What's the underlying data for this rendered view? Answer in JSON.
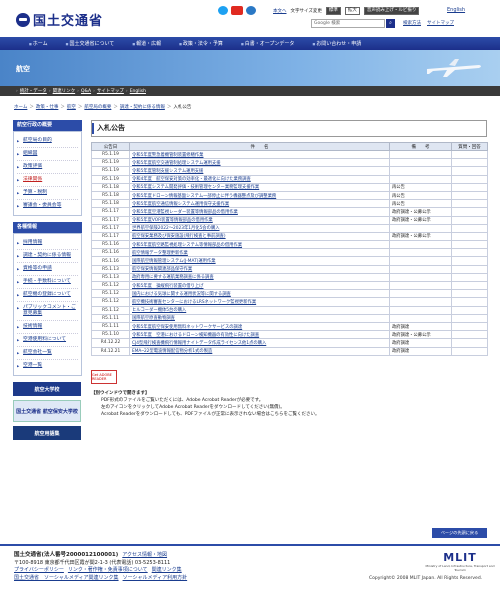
{
  "header": {
    "logo": "国土交通省",
    "links": [
      "本文へ",
      "文字サイズ変更",
      "標準",
      "拡大",
      "音声読み上げ・ルビ振り",
      "English"
    ],
    "search_placeholder": "Google 検索",
    "sub_links": [
      "検索方法",
      "サイトマップ"
    ]
  },
  "gnav": [
    "ホーム",
    "国土交通省について",
    "報道・広報",
    "政策・法令・予算",
    "白書・オープンデータ",
    "お問い合わせ・申請"
  ],
  "banner": {
    "title": "航空"
  },
  "subnav": [
    "統計・データ",
    "関連リンク",
    "Q&A",
    "サイトマップ",
    "English"
  ],
  "breadcrumb": [
    "ホーム",
    "政策・仕事",
    "航空",
    "航空局の概要",
    "調達・契約に係る情報",
    "入札公告"
  ],
  "side": {
    "sec1_title": "航空行政の概要",
    "sec1_items": [
      "航空局の目的",
      "組織図",
      "政策評価",
      "法律関係",
      "予算・税制",
      "審議会・委員会等"
    ],
    "sec2_title": "各種情報",
    "sec2_items": [
      "採用情報",
      "調達・契約に係る情報",
      "資格等の申請",
      "手続・手数料について",
      "航空機の登録について",
      "パブリックコメント・ご意見募集",
      "技術情報",
      "空港使用料について",
      "航空会社一覧",
      "空港一覧"
    ],
    "banners": [
      "航空大学校",
      "国土交通省 航空保安大学校",
      "航空用語集"
    ]
  },
  "main": {
    "title": "入札公告",
    "columns": [
      "公告日",
      "件　　名",
      "備　　考",
      "質問・回答"
    ],
    "rows": [
      {
        "date": "R5.1.19",
        "title": "令和5年度警急着機管制装置修繕作業",
        "note": "",
        "qa": ""
      },
      {
        "date": "R5.1.19",
        "title": "令和5年度航空交通管制処理システム運用支援",
        "note": "",
        "qa": ""
      },
      {
        "date": "R5.1.19",
        "title": "令和5年度管制支援システム運用支援",
        "note": "",
        "qa": ""
      },
      {
        "date": "R5.1.19",
        "title": "令和4年度　航空保安対策の効率化・最適化に向けた業務調査",
        "note": "",
        "qa": ""
      },
      {
        "date": "R5.1.18",
        "title": "令和5年度システム開発評価・技術管理センター業務監理支援作業",
        "note": "再公告",
        "qa": ""
      },
      {
        "date": "R5.1.18",
        "title": "令和5年度ドローン情報基盤システム一部停止に伴う機器整点及び調整業務",
        "note": "再公告",
        "qa": ""
      },
      {
        "date": "R5.1.18",
        "title": "令和5年度航空通信情報システム運用保守支援作業",
        "note": "再公告",
        "qa": ""
      },
      {
        "date": "R5.1.17",
        "title": "令和5年度空港監視レーダー装置等情報部品の借用作業",
        "note": "政府調達・公募公示",
        "qa": ""
      },
      {
        "date": "R5.1.17",
        "title": "令和5年度VOR装置等情報部品の借用作業",
        "note": "政府調達・公募公示",
        "qa": ""
      },
      {
        "date": "R5.1.17",
        "title": "世界航空保険2022～2023年1月化5会の購入",
        "note": "",
        "qa": ""
      },
      {
        "date": "R5.1.17",
        "title": "航空保安業務及び保安施設(飛行検査と事前調査)",
        "note": "政府調達・公募公示",
        "qa": ""
      },
      {
        "date": "R5.1.16",
        "title": "令和5年度航空路監視処理システム等情報部品の借用作業",
        "note": "",
        "qa": ""
      },
      {
        "date": "R5.1.16",
        "title": "航空情報データ整理更新作業",
        "note": "",
        "qa": ""
      },
      {
        "date": "R5.1.16",
        "title": "国際航空情報管理システム(J-MAT)運用作業",
        "note": "",
        "qa": ""
      },
      {
        "date": "R5.1.13",
        "title": "航空保安情報関連部品保守作業",
        "note": "",
        "qa": ""
      },
      {
        "date": "R5.1.13",
        "title": "政府専用に要する運航業務調査に係る調査",
        "note": "",
        "qa": ""
      },
      {
        "date": "R5.1.12",
        "title": "令和5年度　操縦飛行装置の借り上げ",
        "note": "",
        "qa": ""
      },
      {
        "date": "R5.1.12",
        "title": "国内における気球に関する運用状況等に関する調査",
        "note": "",
        "qa": ""
      },
      {
        "date": "R5.1.12",
        "title": "航空機技術審査センターにおけるLRSネットワーク監視更新作業",
        "note": "",
        "qa": ""
      },
      {
        "date": "R5.1.12",
        "title": "ヒルコーダー機体5台の購入",
        "note": "",
        "qa": ""
      },
      {
        "date": "R5.1.11",
        "title": "国際航空原査動物調査",
        "note": "",
        "qa": ""
      },
      {
        "date": "R5.1.11",
        "title": "令和5年度航空保安使用無料ネットワークサービスの調達",
        "note": "政府調達",
        "qa": ""
      },
      {
        "date": "R5.1.10",
        "title": "令和5年度　空港におけるドローン検知機器の有効性に向けた調査",
        "note": "政府調達・公募公示",
        "qa": ""
      },
      {
        "date": "R4.12.22",
        "title": "CJ4型飛行検査機飛行情報用ナイトデータ作成ライセンス他1点の購入",
        "note": "政府調達",
        "qa": ""
      },
      {
        "date": "R4.12.21",
        "title": "EMA─22型電波情報配信物分析1式の製造",
        "note": "政府調達",
        "qa": ""
      }
    ],
    "pdf_label": "Get ADOBE READER",
    "note_head": "【別ウインドウで開きます】",
    "note_lines": [
      "PDF形式のファイルをご覧いただくには、Adobe Acrobat Readerが必要です。",
      "左のアイコンをクリックしてAdobe Acrobat Readerをダウンロードしてください(無償)。",
      "Acrobat Readerをダウンロードしても、PDFファイルが正常に表示されない場合はこちらをご覧ください。"
    ],
    "back_top": "ページの先頭に戻る"
  },
  "footer": {
    "org": "国土交通省(法人番号2000012100001)",
    "access": "アクセス情報・地図",
    "address": "〒100-8918 東京都千代田区霞が関2-1-3 (代表電話) 03-5253-8111",
    "links1": [
      "プライバシーポリシー",
      "リンク・著作権・免責事項について",
      "関連リンク集"
    ],
    "links2": [
      "国土交通省　ソーシャルメディア関連リンク集",
      "ソーシャルメディア利用方針"
    ],
    "mlit": "MLIT",
    "mlit_sub": "Ministry of Land, Infrastructure, Transport and Tourism",
    "copyright": "Copyright© 2008 MLIT Japan. All Rights Reserved."
  }
}
